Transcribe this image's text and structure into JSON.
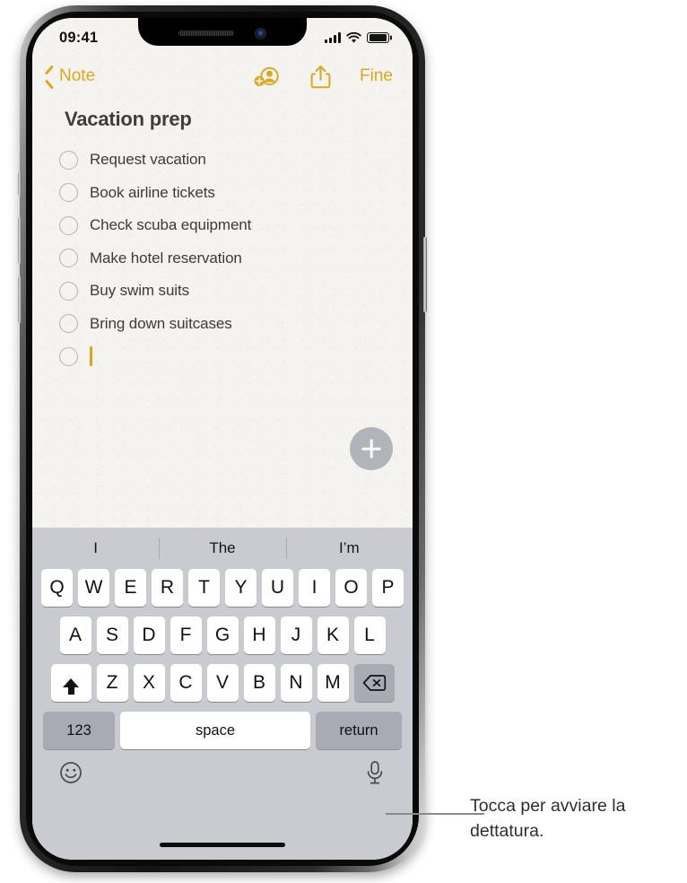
{
  "status_bar": {
    "time": "09:41",
    "signal_icon": "cellular-signal-icon",
    "wifi_icon": "wifi-icon",
    "battery_icon": "battery-full-icon"
  },
  "navbar": {
    "back_label": "Note",
    "back_icon": "chevron-left-icon",
    "add_person_icon": "add-person-icon",
    "share_icon": "share-icon",
    "done_label": "Fine"
  },
  "note": {
    "title": "Vacation prep",
    "checklist": [
      {
        "text": "Request vacation",
        "checked": false
      },
      {
        "text": "Book airline tickets",
        "checked": false
      },
      {
        "text": "Check scuba equipment",
        "checked": false
      },
      {
        "text": "Make hotel reservation",
        "checked": false
      },
      {
        "text": "Buy swim suits",
        "checked": false
      },
      {
        "text": "Bring down suitcases",
        "checked": false
      },
      {
        "text": "",
        "checked": false,
        "active": true
      }
    ],
    "add_attachment_icon": "plus-icon"
  },
  "keyboard": {
    "predictions": [
      "I",
      "The",
      "I’m"
    ],
    "row1": [
      "Q",
      "W",
      "E",
      "R",
      "T",
      "Y",
      "U",
      "I",
      "O",
      "P"
    ],
    "row2": [
      "A",
      "S",
      "D",
      "F",
      "G",
      "H",
      "J",
      "K",
      "L"
    ],
    "row3": [
      "Z",
      "X",
      "C",
      "V",
      "B",
      "N",
      "M"
    ],
    "shift_icon": "shift-arrow-icon",
    "delete_icon": "delete-backward-icon",
    "numeric_label": "123",
    "space_label": "space",
    "return_label": "return",
    "emoji_icon": "emoji-smiley-icon",
    "dictation_icon": "microphone-icon"
  },
  "callout": {
    "text": "Tocca per avviare la dettatura."
  },
  "colors": {
    "accent": "#DDA71C",
    "note_background": "#f4f3f0",
    "keyboard_background": "#c9cbd1",
    "key_white": "#ffffff",
    "key_gray": "#a8abb4",
    "text_primary": "#3b3b3d"
  }
}
